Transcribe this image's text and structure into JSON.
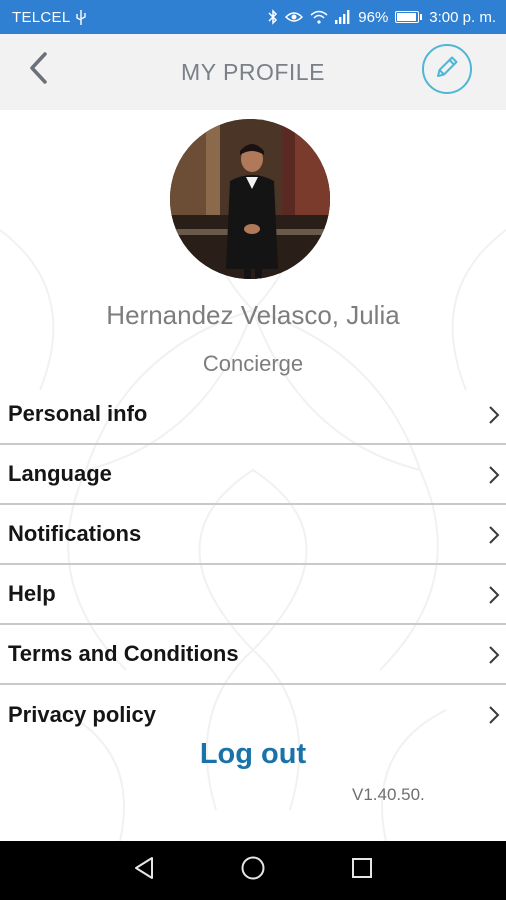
{
  "status_bar": {
    "carrier": "TELCEL",
    "usb_icon": "usb-icon",
    "battery_percent": "96%",
    "time": "3:00 p. m.",
    "icons": [
      "bluetooth-icon",
      "eye-icon",
      "wifi-icon",
      "signal-icon",
      "battery-icon"
    ]
  },
  "header": {
    "title": "MY PROFILE",
    "back_icon": "chevron-left-icon",
    "edit_icon": "pencil-icon"
  },
  "profile": {
    "name": "Hernandez Velasco, Julia",
    "role": "Concierge"
  },
  "menu": {
    "items": [
      {
        "label": "Personal info"
      },
      {
        "label": "Language"
      },
      {
        "label": "Notifications"
      },
      {
        "label": "Help"
      },
      {
        "label": "Terms and Conditions"
      },
      {
        "label": "Privacy policy"
      }
    ]
  },
  "footer": {
    "logout_label": "Log out",
    "version": "V1.40.50."
  },
  "colors": {
    "status_bar": "#2f7fd3",
    "accent": "#4fb6d6",
    "logout": "#1a73a8",
    "header_bg": "#f2f2f2"
  }
}
